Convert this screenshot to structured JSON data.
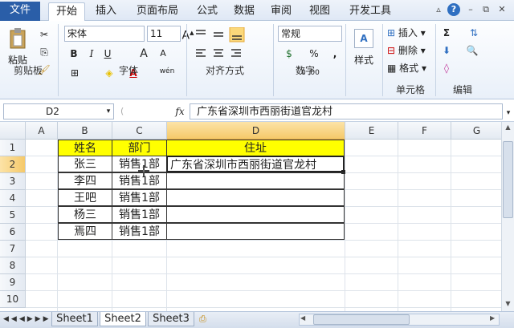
{
  "tabs": {
    "file": "文件",
    "home": "开始",
    "insert": "插入",
    "layout": "页面布局",
    "formulas": "公式",
    "data": "数据",
    "review": "审阅",
    "view": "视图",
    "developer": "开发工具"
  },
  "ribbon": {
    "clipboard": {
      "label": "剪贴板",
      "paste": "粘贴"
    },
    "font": {
      "label": "字体",
      "name": "宋体",
      "size": "11",
      "bold": "B",
      "italic": "I",
      "underline": "U",
      "grow": "A",
      "shrink": "A",
      "fontcolor": "A",
      "wen": "wén"
    },
    "align": {
      "label": "对齐方式"
    },
    "number": {
      "label": "数字",
      "format": "常规",
      "percent": "%",
      "comma": ","
    },
    "styles": {
      "label": "样式",
      "btn": "样式"
    },
    "cells": {
      "label": "单元格",
      "insert": "插入",
      "delete": "删除",
      "format": "格式"
    },
    "editing": {
      "label": "编辑",
      "sum": "Σ"
    }
  },
  "formula_bar": {
    "name_box": "D2",
    "fx": "fx",
    "content": "广东省深圳市西丽街道官龙村"
  },
  "grid": {
    "columns": [
      "A",
      "B",
      "C",
      "D",
      "E",
      "F",
      "G"
    ],
    "rows": [
      "1",
      "2",
      "3",
      "4",
      "5",
      "6",
      "7",
      "8",
      "9",
      "10"
    ],
    "header": {
      "name": "姓名",
      "dept": "部门",
      "addr": "住址"
    },
    "data": [
      {
        "name": "张三",
        "dept": "销售1部",
        "addr": "广东省深圳市西丽街道官龙村"
      },
      {
        "name": "李四",
        "dept": "销售1部",
        "addr": ""
      },
      {
        "name": "王吧",
        "dept": "销售1部",
        "addr": ""
      },
      {
        "name": "杨三",
        "dept": "销售1部",
        "addr": ""
      },
      {
        "name": "焉四",
        "dept": "销售1部",
        "addr": ""
      }
    ]
  },
  "sheets": [
    "Sheet1",
    "Sheet2",
    "Sheet3"
  ],
  "active_sheet": "Sheet2",
  "colors": {
    "file_tab": "#2a5ea8",
    "header_fill": "#ffff00",
    "selection": "#f5c96a"
  }
}
